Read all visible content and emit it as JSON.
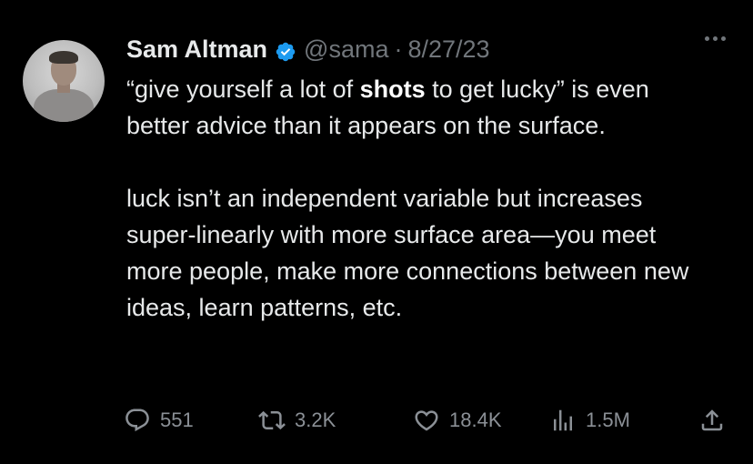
{
  "author": {
    "name": "Sam Altman",
    "handle": "@sama",
    "separator": "·",
    "date": "8/27/23",
    "verified_color": "#1d9bf0"
  },
  "tweet": {
    "p1_before": "“give yourself a lot of ",
    "p1_bold": "shots",
    "p1_after": " to get lucky” is even better advice than it appears on the surface.",
    "p2": "luck isn’t an independent variable but increases super-linearly with more surface area—you meet more people, make more connections between new ideas, learn patterns, etc."
  },
  "actions": {
    "replies": "551",
    "reposts": "3.2K",
    "likes": "18.4K",
    "views": "1.5M"
  },
  "icons": {
    "reply": "reply-icon",
    "repost": "repost-icon",
    "like": "heart-icon",
    "views": "views-icon",
    "share": "share-icon",
    "more": "more-icon"
  }
}
